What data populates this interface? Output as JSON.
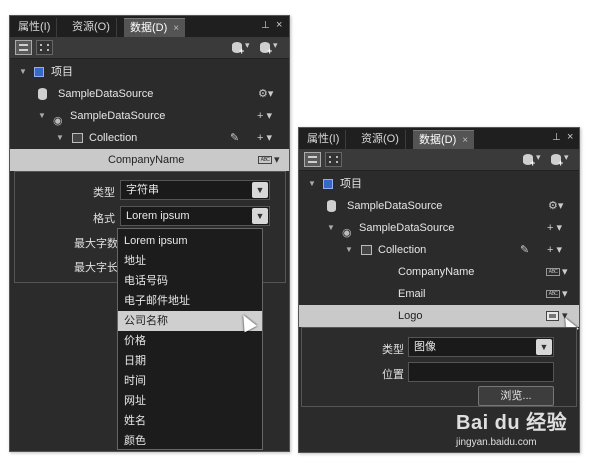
{
  "tabs": [
    "属性(I)",
    "资源(O)",
    "数据(D)"
  ],
  "tab_close": "×",
  "pin_icon": "pin-icon",
  "project_label": "项目",
  "tree1": {
    "datasource": "SampleDataSource",
    "datasource_child": "SampleDataSource",
    "collection": "Collection",
    "field": "CompanyName",
    "type_icon": "ABC"
  },
  "popup1": {
    "type_label": "类型",
    "type_value": "字符串",
    "format_label": "格式",
    "format_value": "Lorem ipsum",
    "maxwords_label": "最大字数",
    "maxlen_label": "最大字长"
  },
  "dropdown_options": [
    "Lorem ipsum",
    "地址",
    "电话号码",
    "电子邮件地址",
    "公司名称",
    "价格",
    "日期",
    "时间",
    "网址",
    "姓名",
    "颜色"
  ],
  "dropdown_hover": "公司名称",
  "tree2": {
    "datasource": "SampleDataSource",
    "datasource_child": "SampleDataSource",
    "collection": "Collection",
    "fields": [
      "CompanyName",
      "Email",
      "Logo"
    ],
    "type_icon": "ABC"
  },
  "popup2": {
    "type_label": "类型",
    "type_value": "图像",
    "location_label": "位置",
    "browse_button": "浏览..."
  },
  "watermark": {
    "logo": "Bai du 经验",
    "url": "jingyan.baidu.com"
  }
}
